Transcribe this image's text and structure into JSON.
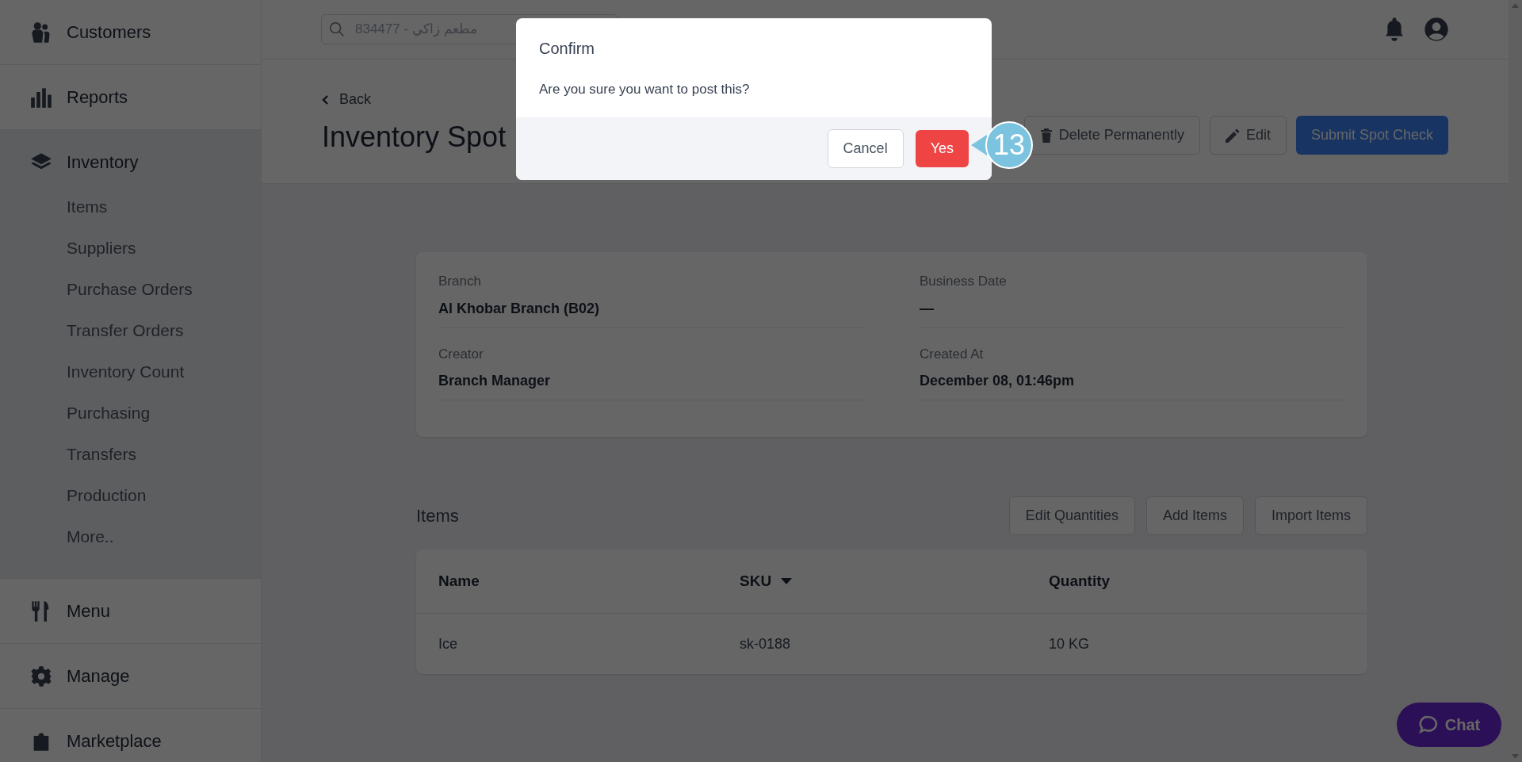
{
  "sidebar": {
    "items": [
      {
        "label": "Customers"
      },
      {
        "label": "Reports"
      },
      {
        "label": "Inventory",
        "children": [
          {
            "label": "Items"
          },
          {
            "label": "Suppliers"
          },
          {
            "label": "Purchase Orders"
          },
          {
            "label": "Transfer Orders"
          },
          {
            "label": "Inventory Count"
          },
          {
            "label": "Purchasing"
          },
          {
            "label": "Transfers"
          },
          {
            "label": "Production"
          },
          {
            "label": "More.."
          }
        ]
      },
      {
        "label": "Menu"
      },
      {
        "label": "Manage"
      },
      {
        "label": "Marketplace"
      }
    ]
  },
  "top_bar": {
    "search": {
      "placeholder": "834477 - مطعم زاكي"
    }
  },
  "header": {
    "back": "Back",
    "title": "Inventory Spot",
    "actions": [
      {
        "label": "Delete Permanently",
        "kind": "delete"
      },
      {
        "label": "Edit",
        "kind": "edit"
      },
      {
        "label": "Submit Spot Check",
        "kind": "primary"
      }
    ]
  },
  "details": {
    "fields": [
      {
        "label": "Branch",
        "value": "Al Khobar Branch (B02)"
      },
      {
        "label": "Business Date",
        "value": "—"
      },
      {
        "label": "Creator",
        "value": "Branch Manager"
      },
      {
        "label": "Created At",
        "value": "December 08, 01:46pm"
      }
    ]
  },
  "items": {
    "title": "Items",
    "actions": [
      "Edit Quantities",
      "Add Items",
      "Import Items"
    ],
    "table": {
      "columns": [
        {
          "label": "Name",
          "sorted": false
        },
        {
          "label": "SKU",
          "sorted": true
        },
        {
          "label": "Quantity",
          "sorted": false
        }
      ],
      "rows": [
        [
          "Ice",
          "sk-0188",
          "10 KG"
        ]
      ]
    }
  },
  "chat_button": "Chat",
  "dialog": {
    "title": "Confirm",
    "message": "Are you sure you want to post this?",
    "buttons": [
      {
        "label": "Cancel",
        "kind": "secondary"
      },
      {
        "label": "Yes",
        "kind": "danger"
      }
    ]
  },
  "callout": {
    "number": "13"
  }
}
